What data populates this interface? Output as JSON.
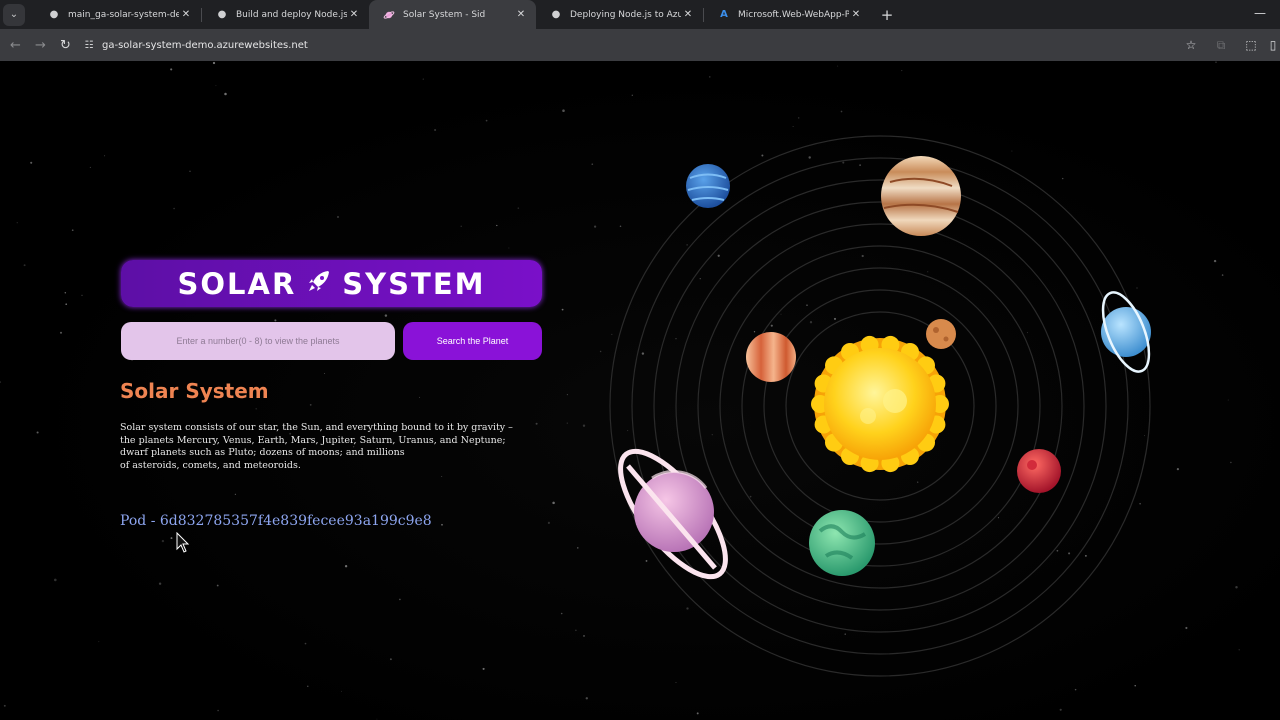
{
  "browser": {
    "tabs": [
      {
        "title": "main_ga-solar-system-demo.ym",
        "icon": "github-icon",
        "active": false
      },
      {
        "title": "Build and deploy Node.js app t",
        "icon": "github-icon",
        "active": false
      },
      {
        "title": "Solar System - Sid",
        "icon": "planet-icon",
        "active": true
      },
      {
        "title": "Deploying Node.js to Azure Ap",
        "icon": "github-icon",
        "active": false
      },
      {
        "title": "Microsoft.Web-WebApp-Portal",
        "icon": "azure-icon",
        "active": false
      }
    ],
    "url": "ga-solar-system-demo.azurewebsites.net"
  },
  "page": {
    "banner_left": "SOLAR",
    "banner_right": "SYSTEM",
    "search_placeholder": "Enter a number(0 - 8) to view the planets",
    "search_button": "Search the Planet",
    "section_title": "Solar System",
    "description_lines": [
      "Solar system consists of our star, the Sun, and everything bound to it by gravity –",
      "the planets Mercury, Venus, Earth, Mars, Jupiter, Saturn, Uranus, and Neptune;",
      "dwarf planets such as Pluto; dozens of moons; and millions",
      "of asteroids, comets, and meteoroids."
    ],
    "pod": "Pod - 6d832785357f4e839fecee93a199c9e8"
  },
  "colors": {
    "accent_purple": "#7a10c9",
    "title_orange": "#ef8452",
    "pod_blue": "#8da5ef"
  }
}
